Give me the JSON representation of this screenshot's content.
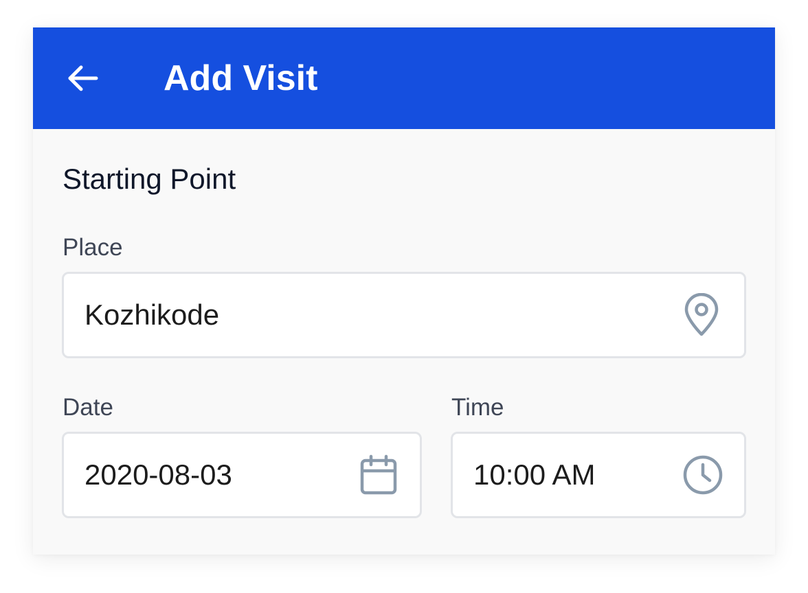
{
  "appbar": {
    "title": "Add Visit",
    "back_icon": "arrow-left-icon",
    "color": "#154fdf"
  },
  "section": {
    "title": "Starting Point"
  },
  "place": {
    "label": "Place",
    "value": "Kozhikode",
    "icon": "map-pin-icon"
  },
  "date": {
    "label": "Date",
    "value": "2020-08-03",
    "icon": "calendar-icon"
  },
  "time": {
    "label": "Time",
    "value": "10:00 AM",
    "icon": "clock-icon"
  },
  "colors": {
    "icon_gray": "#8a9aab",
    "background": "#f9f9f9"
  }
}
